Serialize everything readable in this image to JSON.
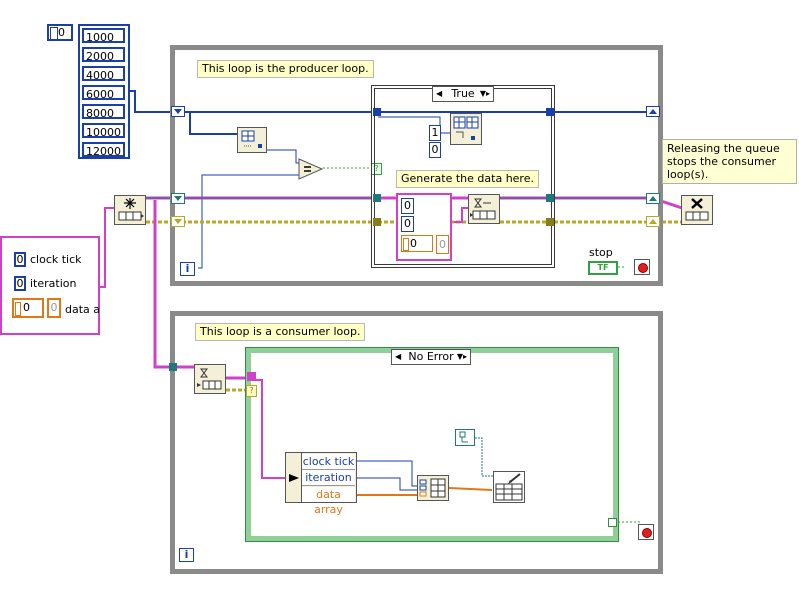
{
  "array_index": "0",
  "timeout_values": [
    "1000",
    "2000",
    "4000",
    "6000",
    "8000",
    "10000",
    "12000"
  ],
  "producer": {
    "label": "This loop is the producer loop.",
    "case_selector": "True",
    "generate_label": "Generate the data here.",
    "const_one": "1",
    "const_zero": "0",
    "cluster_values": [
      "0",
      "0"
    ],
    "cluster_array_value": "0",
    "cluster_array_index": "0",
    "stop_label": "stop",
    "stop_bool": "TF"
  },
  "release_comment": "Releasing the queue stops the consumer loop(s).",
  "cluster_control": {
    "clock_tick_value": "0",
    "clock_tick_label": "clock tick",
    "iteration_value": "0",
    "iteration_label": "iteration",
    "data_array_index": "0",
    "data_array_value": "0",
    "data_array_label": "data a"
  },
  "consumer": {
    "label": "This loop is a consumer loop.",
    "case_selector": "No Error",
    "unbundle": [
      "clock tick",
      "iteration",
      "data array"
    ]
  },
  "iteration_terminal": "i",
  "colors": {
    "loop_border": "#8a8a8a",
    "case_border": "#3a3a3a",
    "error_case_border": "#2f8f3f",
    "blue_wire": "#1a3fa8",
    "pink_wire": "#d040c8",
    "yellow_wire": "#b8a828",
    "orange_wire": "#e07818",
    "teal_wire": "#207878"
  }
}
